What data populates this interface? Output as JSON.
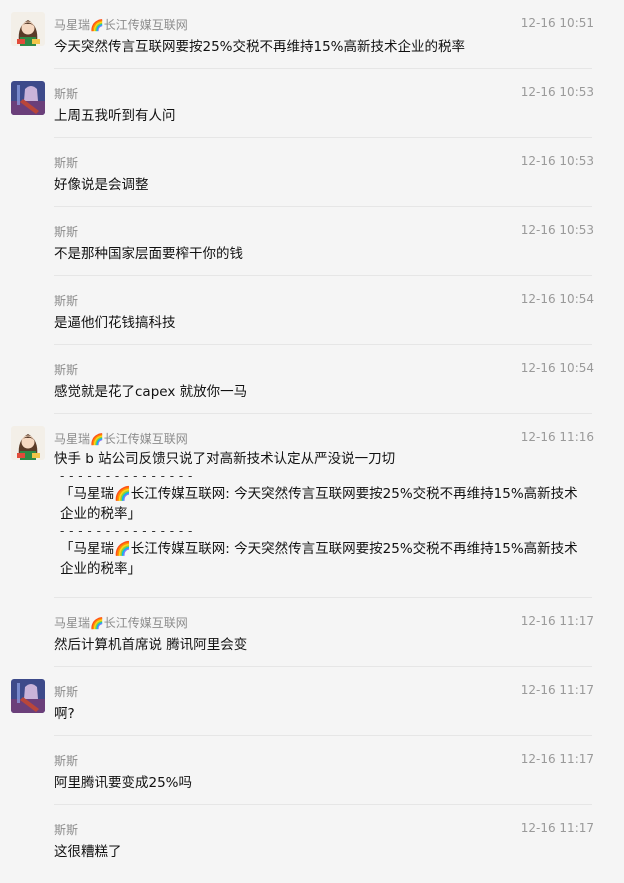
{
  "messages": [
    {
      "sender": "马星瑞",
      "badge": "🌈",
      "org": "长江传媒互联网",
      "time": "12-16 10:51",
      "text": "今天突然传言互联网要按25%交税不再维持15%高新技术企业的税率",
      "avatar": "female-cartoon"
    },
    {
      "sender": "斯斯",
      "time": "12-16 10:53",
      "text": "上周五我听到有人问",
      "avatar": "anime-guitar"
    },
    {
      "sender": "斯斯",
      "time": "12-16 10:53",
      "text": "好像说是会调整"
    },
    {
      "sender": "斯斯",
      "time": "12-16 10:53",
      "text": "不是那种国家层面要榨干你的钱"
    },
    {
      "sender": "斯斯",
      "time": "12-16 10:54",
      "text": "是逼他们花钱搞科技"
    },
    {
      "sender": "斯斯",
      "time": "12-16 10:54",
      "text": "感觉就是花了capex 就放你一马"
    },
    {
      "sender": "马星瑞",
      "badge": "🌈",
      "org": "长江传媒互联网",
      "time": "12-16 11:16",
      "text": "快手 b 站公司反馈只说了对高新技术认定从严没说一刀切",
      "avatar": "female-cartoon",
      "separator": "- - - - - - - - - - - - - - -",
      "quote1_l1": "「马星瑞🌈长江传媒互联网: 今天突然传言互联网要按25%交税不再维持15%高新技术",
      "quote1_l2": "企业的税率」",
      "quote2_l1": "「马星瑞🌈长江传媒互联网: 今天突然传言互联网要按25%交税不再维持15%高新技术",
      "quote2_l2": "企业的税率」"
    },
    {
      "sender": "马星瑞",
      "badge": "🌈",
      "org": "长江传媒互联网",
      "time": "12-16 11:17",
      "text": "然后计算机首席说 腾讯阿里会变"
    },
    {
      "sender": "斯斯",
      "time": "12-16 11:17",
      "text": "啊?",
      "avatar": "anime-guitar"
    },
    {
      "sender": "斯斯",
      "time": "12-16 11:17",
      "text": "阿里腾讯要变成25%吗"
    },
    {
      "sender": "斯斯",
      "time": "12-16 11:17",
      "text": "这很糟糕了"
    }
  ],
  "colors": {
    "background": "#f5f5f5",
    "meta": "#8c8c8c",
    "text": "#111111",
    "divider": "#e6e6e6"
  }
}
